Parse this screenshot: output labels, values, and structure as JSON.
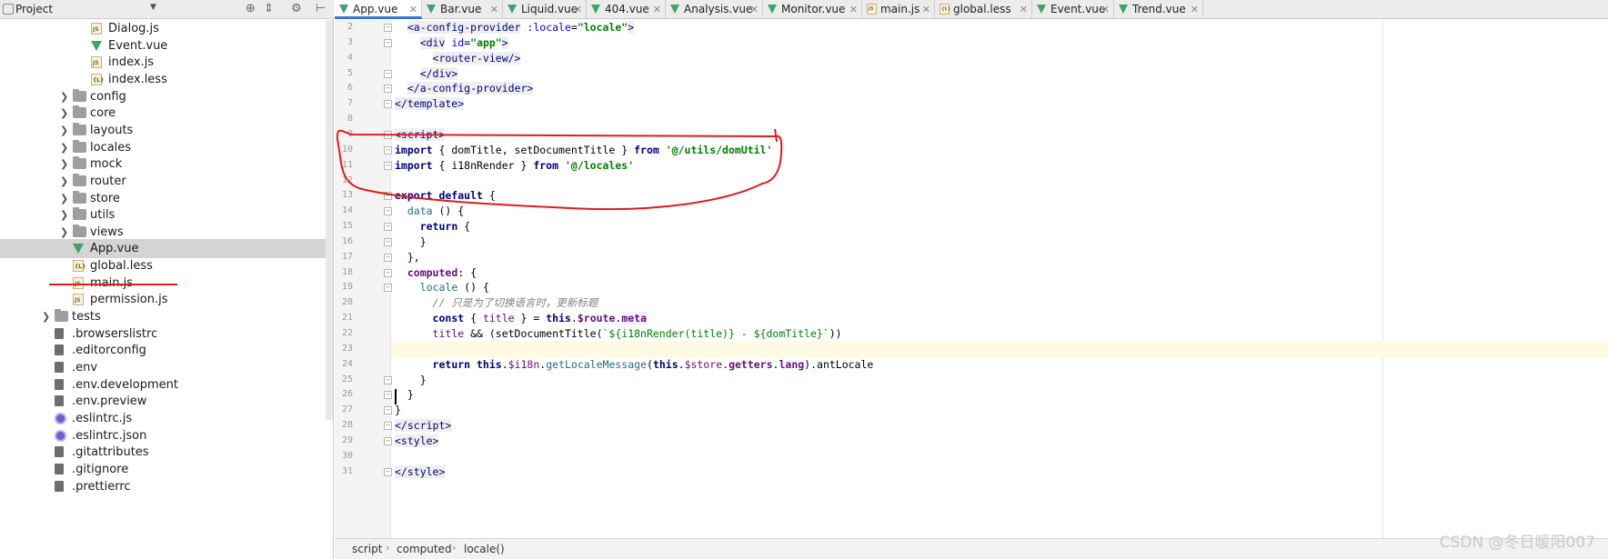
{
  "project_panel": {
    "title": "Project",
    "dropdown_icon": "triangle-down-icon",
    "tools": [
      "target-icon",
      "collapse-icon",
      "gear-icon",
      "hide-icon"
    ],
    "tree": [
      {
        "label": "Dialog.js",
        "type": "js",
        "indent": 108
      },
      {
        "label": "Event.vue",
        "type": "vue",
        "indent": 108
      },
      {
        "label": "index.js",
        "type": "js",
        "indent": 108
      },
      {
        "label": "index.less",
        "type": "less",
        "indent": 108
      },
      {
        "label": "config",
        "type": "folder",
        "indent": 88,
        "arrow": true
      },
      {
        "label": "core",
        "type": "folder",
        "indent": 88,
        "arrow": true
      },
      {
        "label": "layouts",
        "type": "folder",
        "indent": 88,
        "arrow": true
      },
      {
        "label": "locales",
        "type": "folder",
        "indent": 88,
        "arrow": true
      },
      {
        "label": "mock",
        "type": "folder",
        "indent": 88,
        "arrow": true
      },
      {
        "label": "router",
        "type": "folder",
        "indent": 88,
        "arrow": true
      },
      {
        "label": "store",
        "type": "folder",
        "indent": 88,
        "arrow": true
      },
      {
        "label": "utils",
        "type": "folder",
        "indent": 88,
        "arrow": true
      },
      {
        "label": "views",
        "type": "folder",
        "indent": 88,
        "arrow": true
      },
      {
        "label": "App.vue",
        "type": "vue",
        "indent": 88,
        "selected": true
      },
      {
        "label": "global.less",
        "type": "less",
        "indent": 88
      },
      {
        "label": "main.js",
        "type": "js",
        "indent": 88
      },
      {
        "label": "permission.js",
        "type": "js",
        "indent": 88
      },
      {
        "label": "tests",
        "type": "folder",
        "indent": 68,
        "arrow": true
      },
      {
        "label": ".browserslistrc",
        "type": "file",
        "indent": 68
      },
      {
        "label": ".editorconfig",
        "type": "file",
        "indent": 68
      },
      {
        "label": ".env",
        "type": "file",
        "indent": 68
      },
      {
        "label": ".env.development",
        "type": "file",
        "indent": 68
      },
      {
        "label": ".env.preview",
        "type": "file",
        "indent": 68
      },
      {
        "label": ".eslintrc.js",
        "type": "eslint",
        "indent": 68
      },
      {
        "label": ".eslintrc.json",
        "type": "eslint",
        "indent": 68
      },
      {
        "label": ".gitattributes",
        "type": "file",
        "indent": 68
      },
      {
        "label": ".gitignore",
        "type": "file",
        "indent": 68
      },
      {
        "label": ".prettierrc",
        "type": "file",
        "indent": 68
      }
    ]
  },
  "tabs": [
    {
      "label": "App.vue",
      "type": "vue",
      "active": true
    },
    {
      "label": "Bar.vue",
      "type": "vue"
    },
    {
      "label": "Liquid.vue",
      "type": "vue"
    },
    {
      "label": "404.vue",
      "type": "vue"
    },
    {
      "label": "Analysis.vue",
      "type": "vue"
    },
    {
      "label": "Monitor.vue",
      "type": "vue"
    },
    {
      "label": "main.js",
      "type": "js"
    },
    {
      "label": "global.less",
      "type": "less"
    },
    {
      "label": "Event.vue",
      "type": "vue"
    },
    {
      "label": "Trend.vue",
      "type": "vue"
    }
  ],
  "editor": {
    "current_line": 23,
    "lines": [
      {
        "n": 2,
        "fold": true,
        "html": "  <span class=\"k-tag\">&lt;a-config-provider</span> <span class=\"k-attr\">:locale</span>=<span class=\"k-str\">\"locale\"</span><span class=\"k-tag\">&gt;</span>"
      },
      {
        "n": 3,
        "fold": true,
        "html": "    <span class=\"k-tag\">&lt;div</span> <span class=\"k-attr\">id</span>=<span class=\"k-str\">\"app\"</span><span class=\"k-tag\">&gt;</span>"
      },
      {
        "n": 4,
        "html": "      <span class=\"k-tag\">&lt;router-view/&gt;</span>"
      },
      {
        "n": 5,
        "fold": true,
        "html": "    <span class=\"k-tag\">&lt;/div&gt;</span>"
      },
      {
        "n": 6,
        "fold": true,
        "html": "  <span class=\"k-tag\">&lt;/a-config-provider&gt;</span>"
      },
      {
        "n": 7,
        "fold": true,
        "html": "<span class=\"k-tag\">&lt;/template&gt;</span>"
      },
      {
        "n": 8,
        "html": ""
      },
      {
        "n": 9,
        "fold": true,
        "html": "<span class=\"k-tag\">&lt;script&gt;</span>"
      },
      {
        "n": 10,
        "fold": true,
        "html": "<span class=\"k-kw\">import</span> { domTitle, setDocumentTitle } <span class=\"k-kw\">from</span> <span class=\"k-str\">'@/utils/domUtil'</span>"
      },
      {
        "n": 11,
        "fold": true,
        "html": "<span class=\"k-kw\">import</span> { i18nRender } <span class=\"k-kw\">from</span> <span class=\"k-str\">'@/locales'</span>"
      },
      {
        "n": 12,
        "html": ""
      },
      {
        "n": 13,
        "fold": true,
        "html": "<span class=\"k-kw\">export default</span> {"
      },
      {
        "n": 14,
        "fold": true,
        "html": "  <span class=\"k-fn\">data</span> () {"
      },
      {
        "n": 15,
        "fold": true,
        "html": "    <span class=\"k-kw\">return</span> {"
      },
      {
        "n": 16,
        "fold": true,
        "html": "    }"
      },
      {
        "n": 17,
        "fold": true,
        "html": "  },"
      },
      {
        "n": 18,
        "fold": true,
        "html": "  <span class=\"k-prop\">computed</span>: {"
      },
      {
        "n": 19,
        "fold": true,
        "html": "    <span class=\"k-fn\">locale</span> () {"
      },
      {
        "n": 20,
        "html": "      <span class=\"k-cm\">// 只是为了切换语言时，更新标题</span>"
      },
      {
        "n": 21,
        "html": "      <span class=\"k-kw\">const</span> { <span class=\"k-prop\" style=\"font-weight:normal\">title</span> } = <span class=\"k-kw\">this</span>.<span class=\"k-prop\">$route</span>.<span class=\"k-prop k-hl\">meta</span>"
      },
      {
        "n": 22,
        "html": "      <span class=\"k-prop\" style=\"font-weight:normal\">title</span> &amp;&amp; (setDocumentTitle(<span class=\"k-str\" style=\"font-weight:normal\">`${i18nRender(title)} - ${domTitle}`</span>))"
      },
      {
        "n": 23,
        "html": ""
      },
      {
        "n": 24,
        "html": "      <span class=\"k-kw\">return this</span>.<span class=\"k-prop\" style=\"font-weight:normal\">$i18n</span>.<span class=\"k-fn\">getLocaleMessage</span>(<span class=\"k-kw\">this</span>.<span class=\"k-prop\" style=\"font-weight:normal\">$store</span>.<span class=\"k-prop\">getters</span>.<span class=\"k-prop\">lang</span>).antLocale"
      },
      {
        "n": 25,
        "fold": true,
        "html": "    }"
      },
      {
        "n": 26,
        "fold": true,
        "html": "  }"
      },
      {
        "n": 27,
        "fold": true,
        "html": "}"
      },
      {
        "n": 28,
        "fold": true,
        "html": "<span class=\"k-tag\">&lt;/script&gt;</span>"
      },
      {
        "n": 29,
        "fold": true,
        "html": "<span class=\"k-tag\">&lt;style&gt;</span>"
      },
      {
        "n": 30,
        "html": ""
      },
      {
        "n": 31,
        "fold": true,
        "html": "<span class=\"k-tag\">&lt;/style&gt;</span>"
      }
    ]
  },
  "breadcrumb": {
    "items": [
      "script",
      "computed",
      "locale()"
    ],
    "separator": "›"
  },
  "watermark": "CSDN @冬日暖阳007",
  "colors": {
    "annotation": "#e01c1c",
    "active_tab_accent": "#3a73d6",
    "selection": "#d4d4d4",
    "vue_icon": "#3fa26a"
  }
}
